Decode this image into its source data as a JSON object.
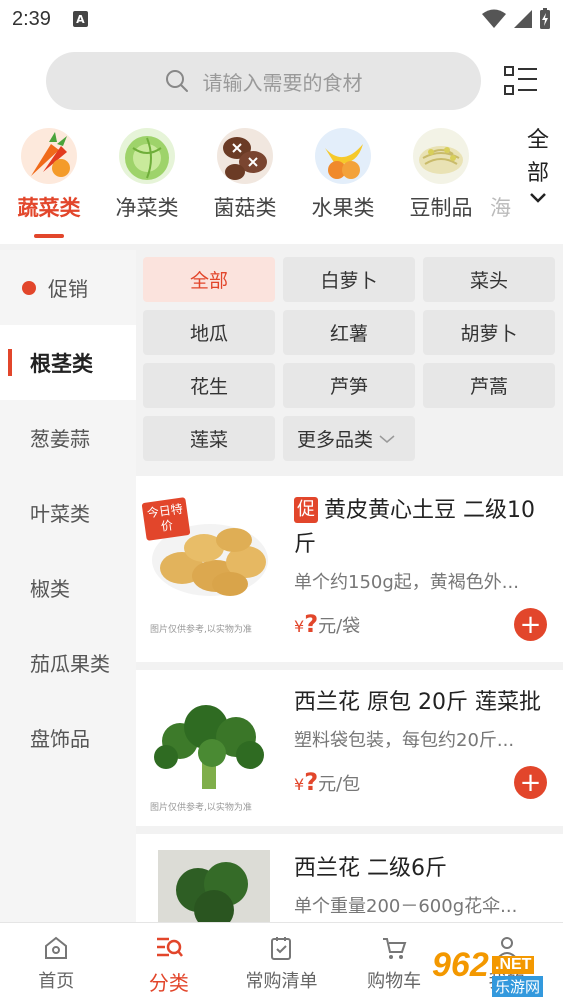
{
  "status_bar": {
    "time": "2:39",
    "notification_letter": "A"
  },
  "search": {
    "placeholder": "请输入需要的食材"
  },
  "categories": [
    {
      "label": "蔬菜类",
      "icon": "vegetables-icon",
      "active": true
    },
    {
      "label": "净菜类",
      "icon": "cabbage-icon",
      "active": false
    },
    {
      "label": "菌菇类",
      "icon": "mushroom-icon",
      "active": false
    },
    {
      "label": "水果类",
      "icon": "fruit-icon",
      "active": false
    },
    {
      "label": "豆制品",
      "icon": "bean-sprout-icon",
      "active": false
    },
    {
      "label": "海",
      "icon": "",
      "active": false
    }
  ],
  "category_all": {
    "line1": "全",
    "line2": "部"
  },
  "sidebar": {
    "items": [
      {
        "label": "促销",
        "type": "promo"
      },
      {
        "label": "根茎类",
        "active": true
      },
      {
        "label": "葱姜蒜"
      },
      {
        "label": "叶菜类"
      },
      {
        "label": "椒类"
      },
      {
        "label": "茄瓜果类"
      },
      {
        "label": "盘饰品"
      }
    ]
  },
  "subcategories": [
    "全部",
    "白萝卜",
    "菜头",
    "地瓜",
    "红薯",
    "胡萝卜",
    "花生",
    "芦笋",
    "芦蒿",
    "莲菜",
    "更多品类"
  ],
  "products": [
    {
      "tag": "促",
      "title": "黄皮黄心土豆 二级10斤",
      "desc": "单个约150g起，黄褐色外...",
      "currency": "¥",
      "price": "?",
      "unit": "元/袋",
      "badge": "今日特价",
      "caption": "图片仅供参考,以实物为准",
      "image": "potato-image"
    },
    {
      "title": "西兰花 原包 20斤 莲菜批",
      "desc": "塑料袋包装，每包约20斤...",
      "currency": "¥",
      "price": "?",
      "unit": "元/包",
      "caption": "图片仅供参考,以实物为准",
      "image": "broccoli-image"
    },
    {
      "title": "西兰花 二级6斤",
      "desc": "单个重量200－600g花伞...",
      "image": "broccoli-photo"
    }
  ],
  "bottom_nav": [
    {
      "label": "首页",
      "icon": "home-icon"
    },
    {
      "label": "分类",
      "icon": "category-icon",
      "active": true
    },
    {
      "label": "常购清单",
      "icon": "list-icon"
    },
    {
      "label": "购物车",
      "icon": "cart-icon"
    },
    {
      "label": "我的",
      "icon": "user-icon"
    }
  ],
  "watermark": {
    "brand": "962",
    "suffix": ".NET",
    "cn": "乐游网"
  },
  "colors": {
    "accent": "#e2462b",
    "background": "#f2f2f2"
  }
}
